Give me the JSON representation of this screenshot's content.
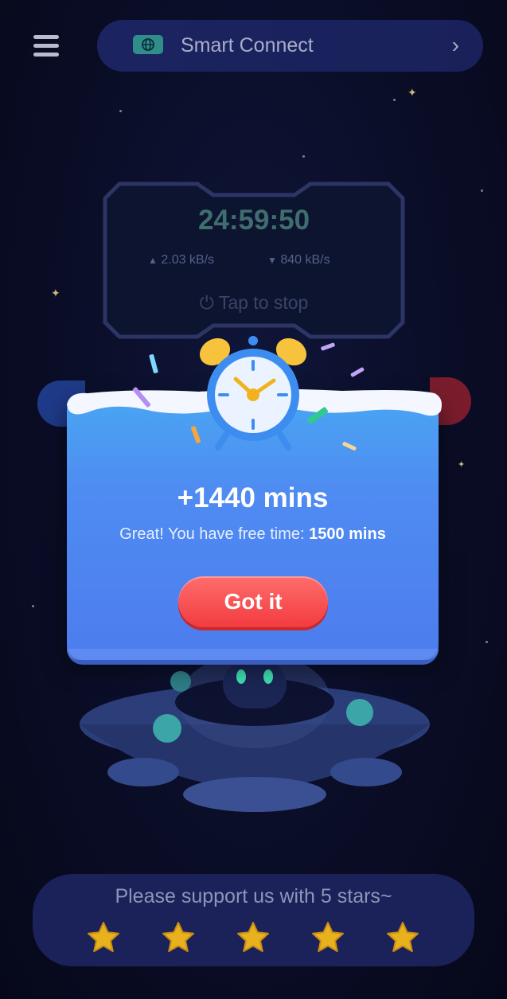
{
  "header": {
    "menu_icon": "hamburger-menu-icon",
    "server_icon": "globe-icon",
    "server_label": "Smart Connect",
    "chevron_icon": "chevron-right-icon"
  },
  "connection": {
    "timer": "24:59:50",
    "upload_speed": "2.03 kB/s",
    "download_speed": "840 kB/s",
    "stop_label": "Tap to stop",
    "power_icon": "power-icon"
  },
  "modal": {
    "illustration": "alarm-clock-icon",
    "title": "+1440 mins",
    "message_prefix": "Great! You have free time: ",
    "message_value": "1500 mins",
    "button_label": "Got it"
  },
  "rating": {
    "prompt": "Please support us with 5 stars~",
    "star_count": 5,
    "star_icon": "star-icon"
  },
  "colors": {
    "background": "#0a0d26",
    "modal_blue": "#4f8cf2",
    "button_red": "#f23b3f",
    "star_gold": "#e8b21f"
  }
}
